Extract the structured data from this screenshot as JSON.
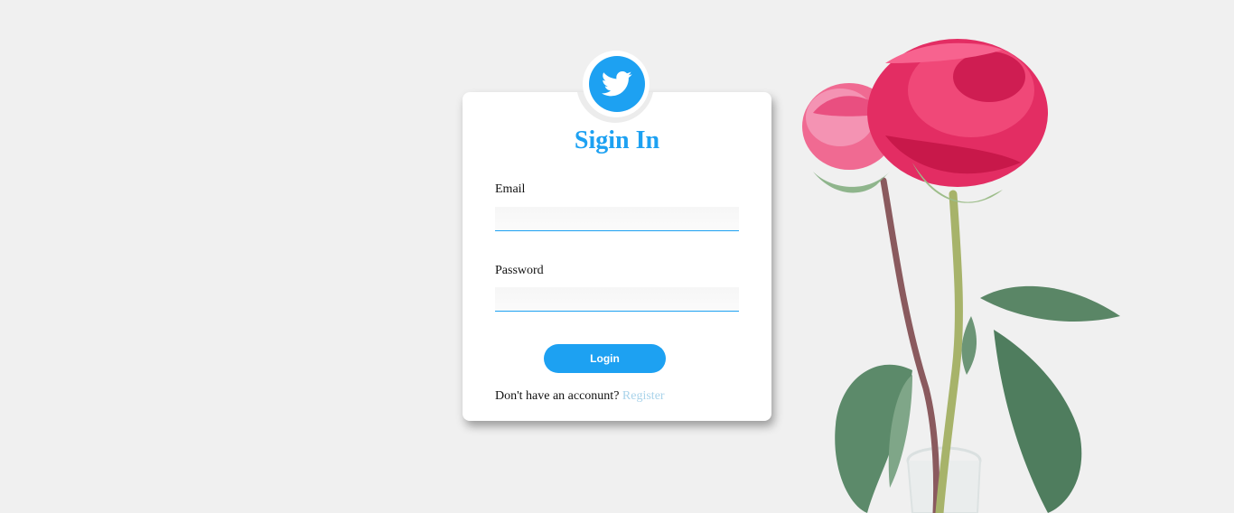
{
  "brand": {
    "icon": "twitter-bird-icon",
    "color": "#1da1f2"
  },
  "form": {
    "title": "Sigin In",
    "email_label": "Email",
    "email_value": "",
    "password_label": "Password",
    "password_value": "",
    "login_label": "Login",
    "register_prompt": "Don't have an acconunt?",
    "register_link": "Register"
  },
  "decor": {
    "image": "rose-illustration"
  }
}
